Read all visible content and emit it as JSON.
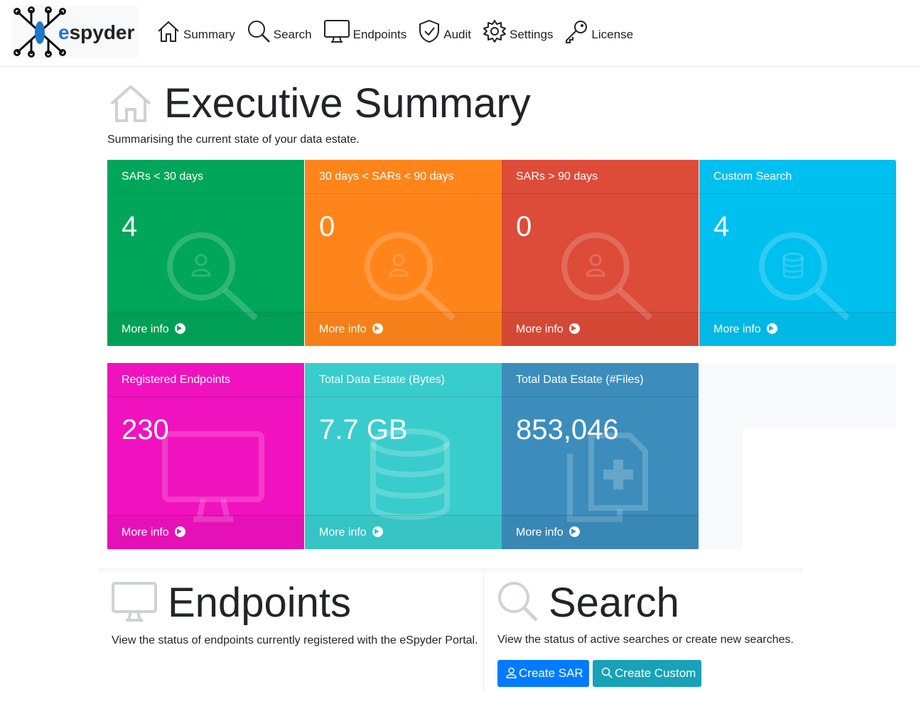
{
  "brand": {
    "name_prefix": "e",
    "name_rest": "spyder"
  },
  "nav": [
    {
      "label": "Summary",
      "icon": "home-icon"
    },
    {
      "label": "Search",
      "icon": "search-icon"
    },
    {
      "label": "Endpoints",
      "icon": "monitor-icon"
    },
    {
      "label": "Audit",
      "icon": "shield-check-icon"
    },
    {
      "label": "Settings",
      "icon": "gear-icon"
    },
    {
      "label": "License",
      "icon": "key-icon"
    }
  ],
  "page": {
    "title": "Executive Summary",
    "subtitle": "Summarising the current state of your data estate."
  },
  "tiles": [
    {
      "title": "SARs < 30 days",
      "value": "4",
      "footer": "More info",
      "color": "#00a65a",
      "icon": "search-person-icon"
    },
    {
      "title": "30 days < SARs < 90 days",
      "value": "0",
      "footer": "More info",
      "color": "#ff851b",
      "icon": "search-person-icon"
    },
    {
      "title": "SARs > 90 days",
      "value": "0",
      "footer": "More info",
      "color": "#dd4b39",
      "icon": "search-person-icon"
    },
    {
      "title": "Custom Search",
      "value": "4",
      "footer": "More info",
      "color": "#00c0ef",
      "icon": "search-database-icon"
    },
    {
      "title": "Registered Endpoints",
      "value": "230",
      "footer": "More info",
      "color": "#f012be",
      "icon": "monitor-icon"
    },
    {
      "title": "Total Data Estate (Bytes)",
      "value": "7.7 GB",
      "footer": "More info",
      "color": "#39cccc",
      "icon": "database-icon"
    },
    {
      "title": "Total Data Estate (#Files)",
      "value": "853,046",
      "footer": "More info",
      "color": "#3c8dbc",
      "icon": "files-plus-icon"
    }
  ],
  "endpoints_section": {
    "title": "Endpoints",
    "text": "View the status of endpoints currently registered with the eSpyder Portal."
  },
  "search_section": {
    "title": "Search",
    "text": "View the status of active searches or create new searches.",
    "create_sar": "Create SAR",
    "create_custom": "Create Custom",
    "create_sar_color": "#007bff",
    "create_custom_color": "#17a2b8"
  }
}
